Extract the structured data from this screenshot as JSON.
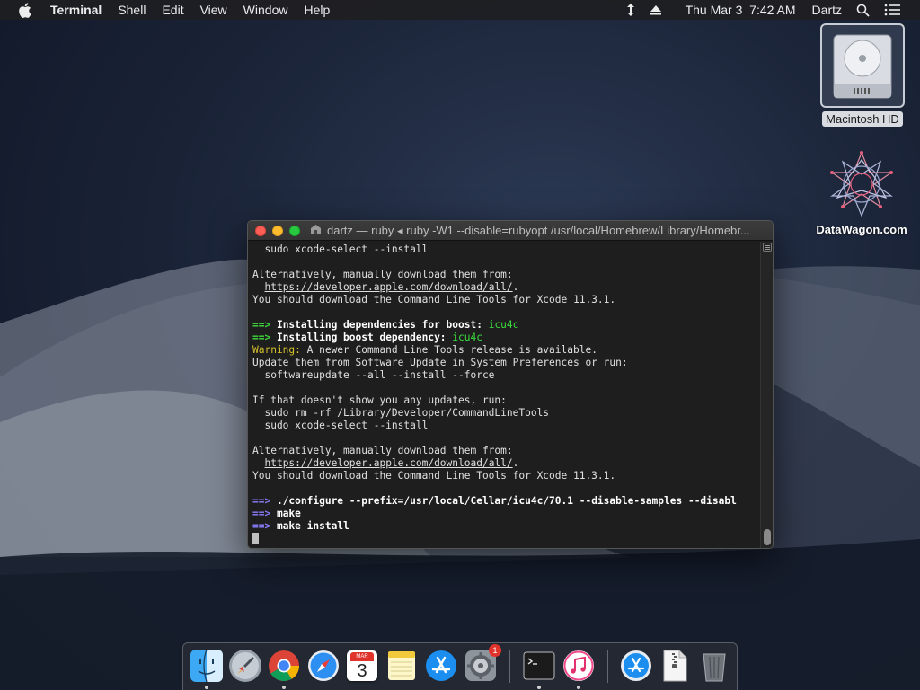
{
  "menubar": {
    "app_name": "Terminal",
    "items": [
      "Shell",
      "Edit",
      "View",
      "Window",
      "Help"
    ],
    "clock": "Thu Mar 3  7:42 AM",
    "user": "Dartz"
  },
  "desktop": {
    "hd_label": "Macintosh HD",
    "datawagon_label": "DataWagon.com"
  },
  "terminal": {
    "title": "dartz — ruby ◂ ruby -W1 --disable=rubyopt /usr/local/Homebrew/Library/Homebr...",
    "lines": {
      "l1": "  sudo xcode-select --install",
      "l2": "",
      "l3": "Alternatively, manually download them from:",
      "l4a": "  ",
      "l4b": "https://developer.apple.com/download/all/",
      "l4c": ".",
      "l5": "You should download the Command Line Tools for Xcode 11.3.1.",
      "l6": "",
      "l7a": "==>",
      "l7b": " Installing dependencies for boost: ",
      "l7c": "icu4c",
      "l8a": "==>",
      "l8b": " Installing boost dependency: ",
      "l8c": "icu4c",
      "l9a": "Warning:",
      "l9b": " A newer Command Line Tools release is available.",
      "l10": "Update them from Software Update in System Preferences or run:",
      "l11": "  softwareupdate --all --install --force",
      "l12": "",
      "l13": "If that doesn't show you any updates, run:",
      "l14": "  sudo rm -rf /Library/Developer/CommandLineTools",
      "l15": "  sudo xcode-select --install",
      "l16": "",
      "l17": "Alternatively, manually download them from:",
      "l18a": "  ",
      "l18b": "https://developer.apple.com/download/all/",
      "l18c": ".",
      "l19": "You should download the Command Line Tools for Xcode 11.3.1.",
      "l20": "",
      "l21a": "==>",
      "l21b": " ./configure --prefix=/usr/local/Cellar/icu4c/70.1 --disable-samples --disabl",
      "l22a": "==>",
      "l22b": " make",
      "l23a": "==>",
      "l23b": " make install"
    }
  },
  "dock": {
    "calendar_month": "MAR",
    "calendar_day": "3",
    "sysprefs_badge": "1"
  },
  "colors": {
    "arrow_green": "#3ddc3d",
    "arrow_purple": "#8a7dff",
    "warning_yellow": "#d6c22a"
  }
}
